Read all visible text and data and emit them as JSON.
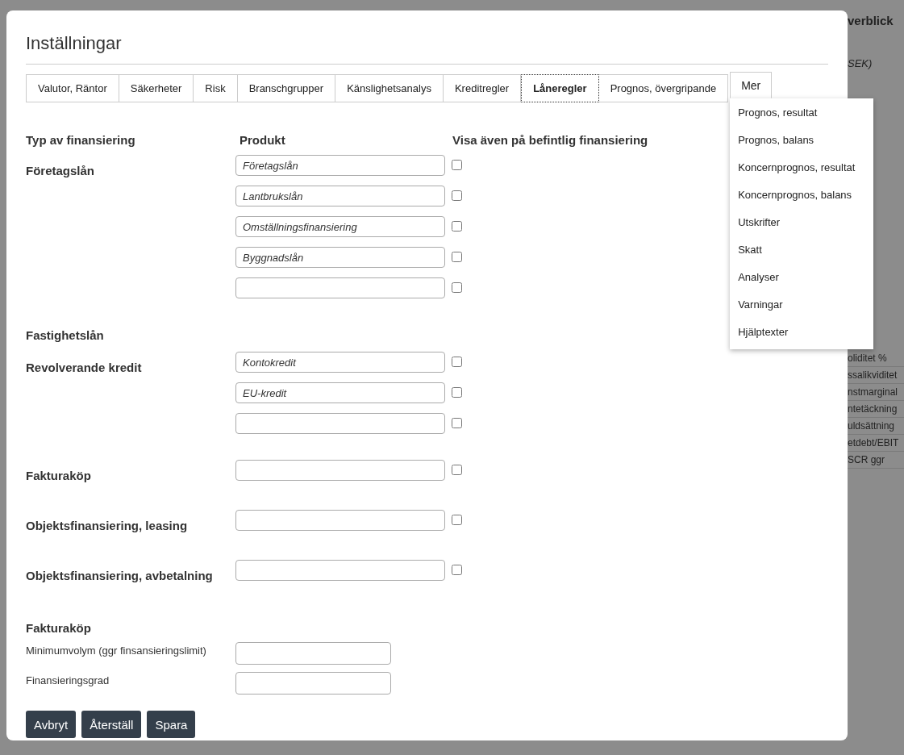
{
  "background": {
    "heading": "verblick",
    "subheading": "SEK)",
    "rows": [
      "oliditet %",
      "ssalikviditet",
      "nstmarginal",
      "ntetäckning",
      "uldsättning",
      "etdebt/EBIT",
      "SCR ggr"
    ]
  },
  "dialog": {
    "title": "Inställningar",
    "tabs": [
      {
        "label": "Valutor, Räntor",
        "selected": false
      },
      {
        "label": "Säkerheter",
        "selected": false
      },
      {
        "label": "Risk",
        "selected": false
      },
      {
        "label": "Branschgrupper",
        "selected": false
      },
      {
        "label": "Känslighetsanalys",
        "selected": false
      },
      {
        "label": "Kreditregler",
        "selected": false
      },
      {
        "label": "Låneregler",
        "selected": true
      },
      {
        "label": "Prognos, övergripande",
        "selected": false
      }
    ],
    "more_tab": {
      "label": "Mer",
      "expanded": true
    },
    "more_menu": [
      "Prognos, resultat",
      "Prognos, balans",
      "Koncernprognos, resultat",
      "Koncernprognos, balans",
      "Utskrifter",
      "Skatt",
      "Analyser",
      "Varningar",
      "Hjälptexter"
    ],
    "columns": [
      "Typ av finansiering",
      "Produkt",
      "Visa även på befintlig finansiering"
    ],
    "groups": [
      {
        "label": "Företagslån",
        "products": [
          {
            "value": "Företagslån",
            "checked": false
          },
          {
            "value": "Lantbrukslån",
            "checked": false
          },
          {
            "value": "Omställningsfinansiering",
            "checked": false
          },
          {
            "value": "Byggnadslån",
            "checked": false
          },
          {
            "checked": false
          }
        ]
      },
      {
        "label": "Fastighetslån"
      },
      {
        "label": "Revolverande kredit",
        "products": [
          {
            "value": "Kontokredit",
            "checked": false
          },
          {
            "value": "EU-kredit",
            "checked": false
          },
          {
            "checked": false
          }
        ]
      },
      {
        "label": "Fakturaköp",
        "products": [
          {
            "checked": false
          }
        ]
      },
      {
        "label": "Objektsfinansiering, leasing",
        "products": [
          {
            "checked": false
          }
        ]
      },
      {
        "label": "Objektsfinansiering, avbetalning",
        "products": [
          {
            "checked": false
          }
        ]
      }
    ],
    "invoice_section": {
      "title": "Fakturaköp",
      "fields": [
        {
          "label": "Minimumvolym (ggr finsansieringslimit)"
        },
        {
          "label": "Finansieringsgrad"
        }
      ]
    },
    "buttons": [
      "Avbryt",
      "Återställ",
      "Spara"
    ]
  }
}
